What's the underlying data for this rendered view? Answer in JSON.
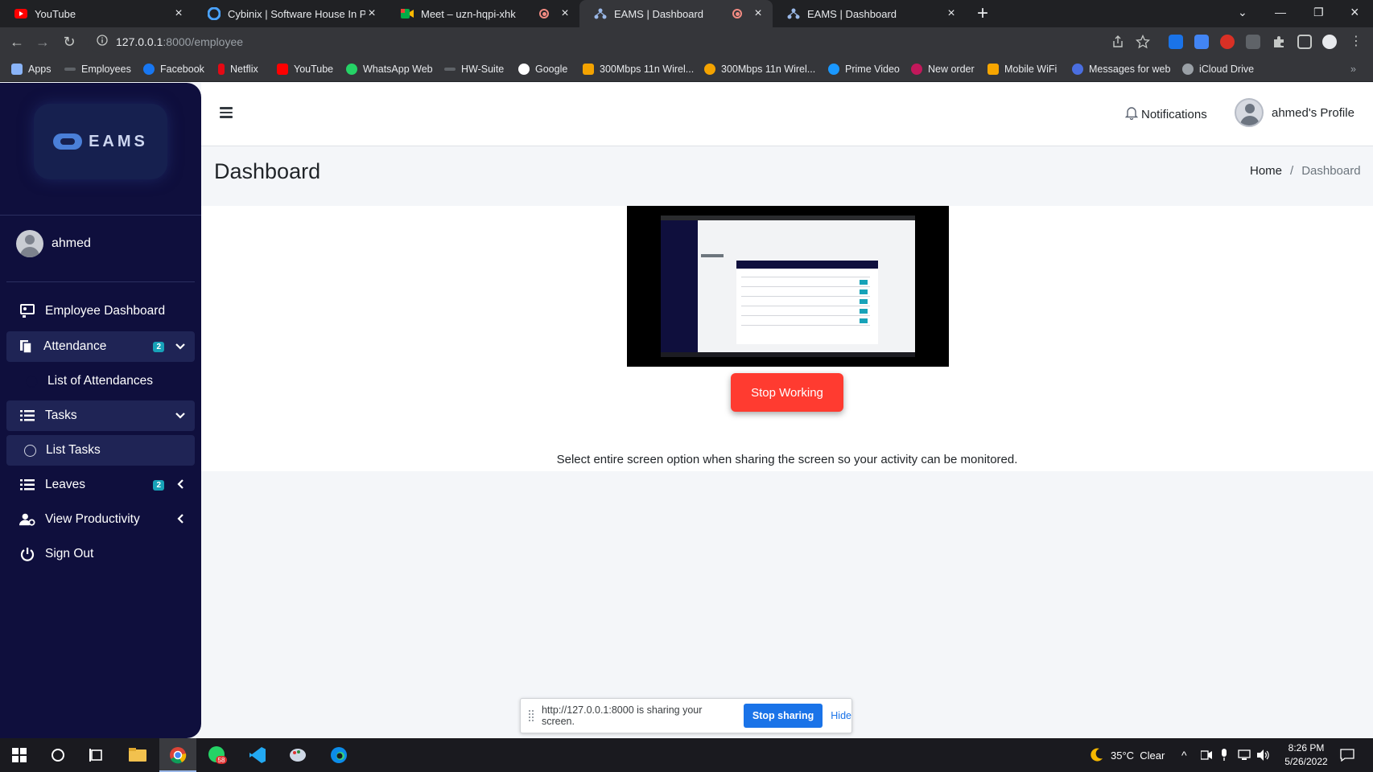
{
  "browser": {
    "tabs": [
      {
        "title": "YouTube",
        "icon": "youtube-icon",
        "active": false
      },
      {
        "title": "Cybinix | Software House In Pakis",
        "icon": "cybinix-icon",
        "active": false
      },
      {
        "title": "Meet – uzn-hqpi-xhk",
        "icon": "google-meet-icon",
        "active": false
      },
      {
        "title": "EAMS | Dashboard",
        "icon": "eams-icon",
        "active": true
      },
      {
        "title": "EAMS | Dashboard",
        "icon": "eams-icon",
        "active": false
      }
    ],
    "url_host": "127.0.0.1",
    "url_path": ":8000/employee",
    "bookmarks": [
      {
        "label": "Apps"
      },
      {
        "label": "Employees"
      },
      {
        "label": "Facebook"
      },
      {
        "label": "Netflix"
      },
      {
        "label": "YouTube"
      },
      {
        "label": "WhatsApp Web"
      },
      {
        "label": "HW-Suite"
      },
      {
        "label": "Google"
      },
      {
        "label": "300Mbps 11n Wirel..."
      },
      {
        "label": "300Mbps 11n Wirel..."
      },
      {
        "label": "Prime Video"
      },
      {
        "label": "New order"
      },
      {
        "label": "Mobile WiFi"
      },
      {
        "label": "Messages for web"
      },
      {
        "label": "iCloud Drive"
      }
    ]
  },
  "sidebar": {
    "logo_text": "EAMS",
    "user_name": "ahmed",
    "items": [
      {
        "label": "Employee Dashboard"
      },
      {
        "label": "Attendance",
        "badge": "2"
      },
      {
        "label": "List of Attendances"
      },
      {
        "label": "Tasks"
      },
      {
        "label": "List Tasks"
      },
      {
        "label": "Leaves",
        "badge": "2"
      },
      {
        "label": "View Productivity"
      },
      {
        "label": "Sign Out"
      }
    ]
  },
  "header": {
    "notifications_label": "Notifications",
    "profile_label": "ahmed's Profile"
  },
  "page": {
    "title": "Dashboard",
    "breadcrumb_home": "Home",
    "breadcrumb_sep": "/",
    "breadcrumb_current": "Dashboard",
    "stop_button": "Stop Working",
    "hint": "Select entire screen option when sharing the screen so your activity can be monitored."
  },
  "share_bar": {
    "message": "http://127.0.0.1:8000 is sharing your screen.",
    "stop_label": "Stop sharing",
    "hide_label": "Hide"
  },
  "taskbar": {
    "weather": "35°C  Clear",
    "time": "8:26 PM",
    "date": "5/26/2022",
    "whatsapp_badge": "58"
  },
  "colors": {
    "sidebar_bg": "#0f0f3d",
    "stop_button": "#ff3b30",
    "badge": "#17a2b8",
    "share_button": "#1a73e8"
  }
}
